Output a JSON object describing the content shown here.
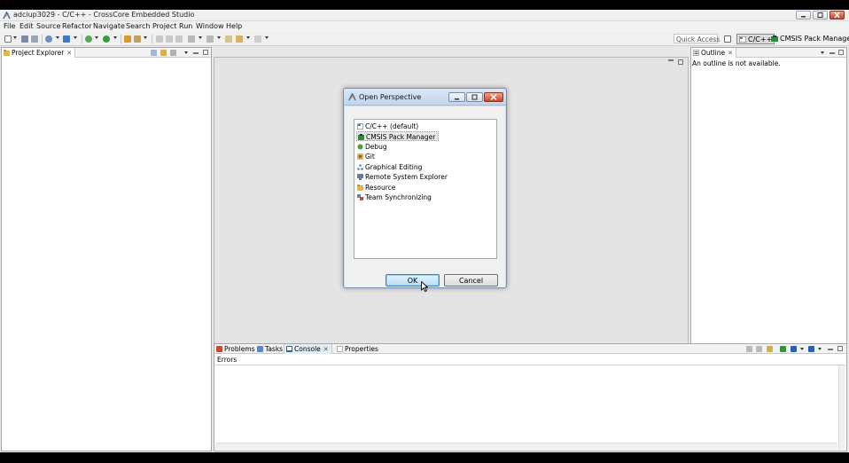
{
  "window": {
    "title": "adciup3029 - C/C++ - CrossCore Embedded Studio"
  },
  "menubar": {
    "items": [
      "File",
      "Edit",
      "Source",
      "Refactor",
      "Navigate",
      "Search",
      "Project",
      "Run",
      "Window",
      "Help"
    ]
  },
  "toolbar": {
    "quick_access_placeholder": "Quick Access",
    "perspectives": [
      "C/C++",
      "CMSIS Pack Manager"
    ]
  },
  "project_explorer": {
    "tab_label": "Project Explorer",
    "close_glyph": "✕"
  },
  "outline": {
    "tab_label": "Outline",
    "close_glyph": "✕",
    "message": "An outline is not available."
  },
  "bottom_panel": {
    "tabs": [
      "Problems",
      "Tasks",
      "Console",
      "Properties"
    ],
    "active_tab": "Console",
    "close_glyph": "✕",
    "content_label": "Errors"
  },
  "dialog": {
    "title": "Open Perspective",
    "items": [
      {
        "label": "C/C++ (default)",
        "icon": "c-cpp-perspective-icon"
      },
      {
        "label": "CMSIS Pack Manager",
        "icon": "cmsis-pack-icon"
      },
      {
        "label": "Debug",
        "icon": "debug-bug-icon"
      },
      {
        "label": "Git",
        "icon": "git-icon"
      },
      {
        "label": "Graphical Editing",
        "icon": "graphical-editing-icon"
      },
      {
        "label": "Remote System Explorer",
        "icon": "remote-system-icon"
      },
      {
        "label": "Resource",
        "icon": "resource-folder-icon"
      },
      {
        "label": "Team Synchronizing",
        "icon": "team-sync-icon"
      }
    ],
    "selected_index": 1,
    "ok_label": "OK",
    "cancel_label": "Cancel"
  },
  "colors": {
    "window_bg": "#e8e8e8",
    "dialog_frame": "#cfdff0",
    "default_button": "#b8dcf2",
    "close_button": "#c9442a"
  }
}
